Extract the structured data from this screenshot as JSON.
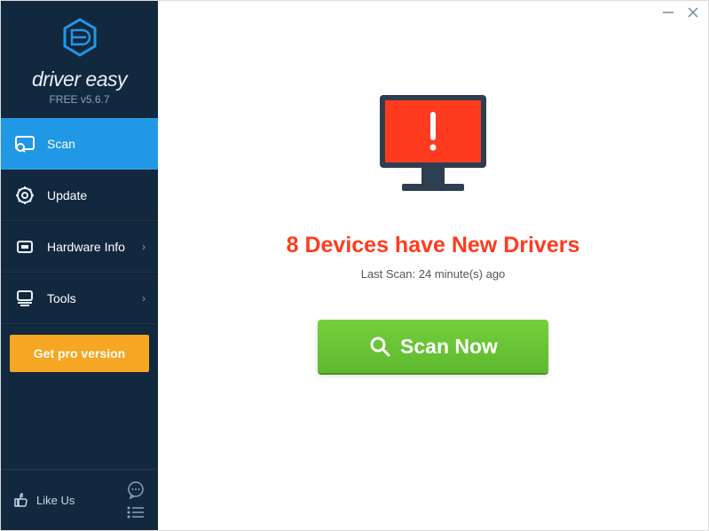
{
  "brand": {
    "name": "driver easy",
    "version_prefix": "FREE ",
    "version": "v5.6.7"
  },
  "sidebar": {
    "items": [
      {
        "label": "Scan",
        "icon": "scan-icon"
      },
      {
        "label": "Update",
        "icon": "gear-icon"
      },
      {
        "label": "Hardware Info",
        "icon": "hardware-icon"
      },
      {
        "label": "Tools",
        "icon": "tools-icon"
      }
    ],
    "pro_button": "Get pro version",
    "like_label": "Like Us"
  },
  "main": {
    "devices_count": 8,
    "headline_prefix": "",
    "headline": "8 Devices have New Drivers",
    "last_scan_label": "Last Scan: 24 minute(s) ago",
    "scan_button": "Scan Now"
  },
  "colors": {
    "sidebar_bg": "#12283f",
    "accent_blue": "#2198e6",
    "accent_orange": "#f5a623",
    "alert_red": "#ff3b1f",
    "scan_green": "#6bc936"
  }
}
